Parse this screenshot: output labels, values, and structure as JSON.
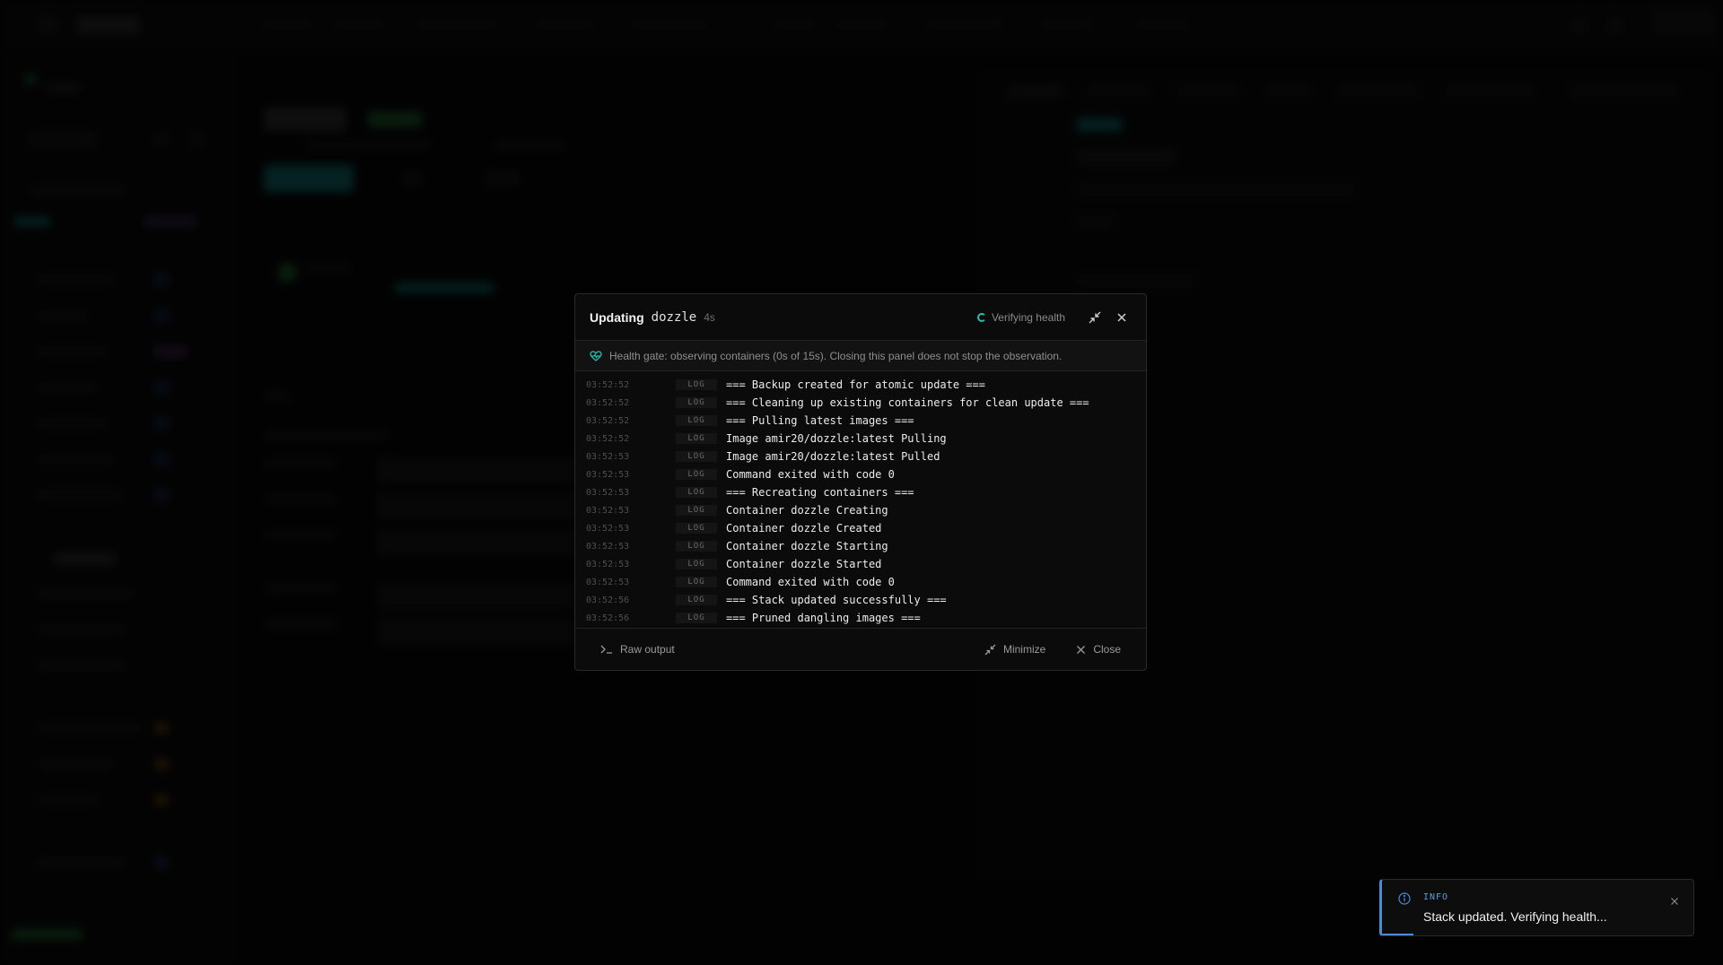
{
  "modal": {
    "title": "Updating",
    "stack_name": "dozzle",
    "elapsed": "4s",
    "status": "Verifying health",
    "health_message": "Health gate: observing containers (0s of 15s). Closing this panel does not stop the observation.",
    "logs": [
      {
        "time": "03:52:52",
        "level": "LOG",
        "message": "=== Backup created for atomic update ==="
      },
      {
        "time": "03:52:52",
        "level": "LOG",
        "message": "=== Cleaning up existing containers for clean update ==="
      },
      {
        "time": "03:52:52",
        "level": "LOG",
        "message": "=== Pulling latest images ==="
      },
      {
        "time": "03:52:52",
        "level": "LOG",
        "message": "Image amir20/dozzle:latest Pulling"
      },
      {
        "time": "03:52:53",
        "level": "LOG",
        "message": "Image amir20/dozzle:latest Pulled"
      },
      {
        "time": "03:52:53",
        "level": "LOG",
        "message": "Command exited with code 0"
      },
      {
        "time": "03:52:53",
        "level": "LOG",
        "message": "=== Recreating containers ==="
      },
      {
        "time": "03:52:53",
        "level": "LOG",
        "message": "Container dozzle Creating"
      },
      {
        "time": "03:52:53",
        "level": "LOG",
        "message": "Container dozzle Created"
      },
      {
        "time": "03:52:53",
        "level": "LOG",
        "message": "Container dozzle Starting"
      },
      {
        "time": "03:52:53",
        "level": "LOG",
        "message": "Container dozzle Started"
      },
      {
        "time": "03:52:53",
        "level": "LOG",
        "message": "Command exited with code 0"
      },
      {
        "time": "03:52:56",
        "level": "LOG",
        "message": "=== Stack updated successfully ==="
      },
      {
        "time": "03:52:56",
        "level": "LOG",
        "message": "=== Pruned dangling images ==="
      }
    ],
    "footer": {
      "raw_output_label": "Raw output",
      "minimize_label": "Minimize",
      "close_label": "Close"
    }
  },
  "toast": {
    "label": "INFO",
    "message": "Stack updated. Verifying health...",
    "progress": 0.1
  },
  "colors": {
    "accent_teal": "#2bbfb3",
    "info_blue": "#4a8bd6"
  }
}
